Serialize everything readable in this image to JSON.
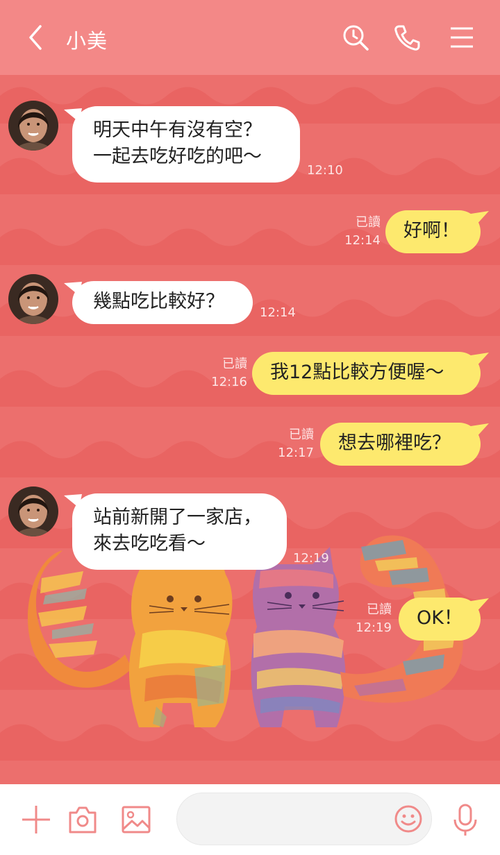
{
  "header": {
    "contact_name": "小美",
    "icons": [
      "back-icon",
      "search-icon",
      "phone-icon",
      "menu-icon"
    ]
  },
  "messages": [
    {
      "from": "other",
      "lines": [
        "明天中午有沒有空？",
        "一起去吃好吃的吧～"
      ],
      "time": "12:10"
    },
    {
      "from": "me",
      "text": "好啊！",
      "read": "已讀",
      "time": "12:14"
    },
    {
      "from": "other",
      "text": "幾點吃比較好？",
      "time": "12:14"
    },
    {
      "from": "me",
      "text": "我12點比較方便喔～",
      "read": "已讀",
      "time": "12:16"
    },
    {
      "from": "me",
      "text": "想去哪裡吃？",
      "read": "已讀",
      "time": "12:17"
    },
    {
      "from": "other",
      "lines": [
        "站前新開了一家店，",
        "來去吃吃看～"
      ],
      "time": "12:19"
    },
    {
      "from": "me",
      "text": "OK！",
      "read": "已讀",
      "time": "12:19"
    }
  ],
  "footer": {
    "message_value": "",
    "icons": [
      "plus-icon",
      "camera-icon",
      "image-icon",
      "emoji-icon",
      "mic-icon"
    ]
  },
  "colors": {
    "header": "#f38887",
    "background": "#ec6f6d",
    "my_bubble": "#fde96e",
    "their_bubble": "#ffffff",
    "icon": "#f08a89"
  }
}
